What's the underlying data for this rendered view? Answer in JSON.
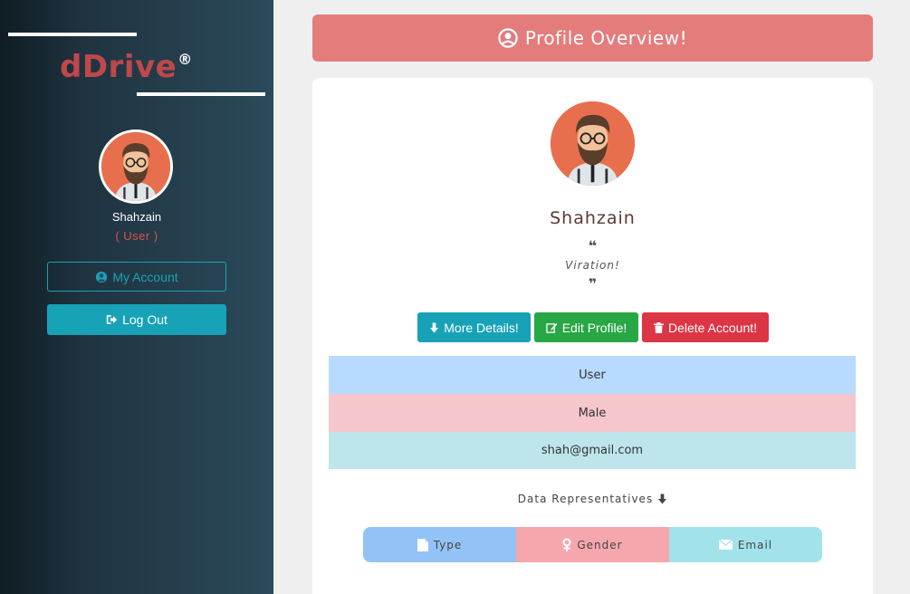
{
  "sidebar": {
    "brand": "dDrive",
    "brand_mark": "®",
    "user_name": "Shahzain",
    "user_role": "( User )",
    "my_account_label": "My Account",
    "logout_label": "Log Out"
  },
  "header": {
    "title": "Profile Overview!"
  },
  "profile": {
    "name": "Shahzain",
    "quote_open": "❝",
    "bio": "Viration!",
    "quote_close": "❞",
    "actions": {
      "details_label": "More Details!",
      "edit_label": "Edit Profile!",
      "delete_label": "Delete Account!"
    },
    "rows": {
      "type": "User",
      "gender": "Male",
      "email": "shah@gmail.com"
    },
    "data_rep_label": "Data Representatives",
    "legend": {
      "type": "Type",
      "gender": "Gender",
      "email": "Email"
    }
  },
  "colors": {
    "header": "#e47c7c",
    "info": "#17a2b8",
    "success": "#28a745",
    "danger": "#dc3545",
    "brand": "#c0474a"
  },
  "icons": [
    "user-circle-icon",
    "logout-icon",
    "arrow-down-icon",
    "edit-icon",
    "trash-icon",
    "file-icon",
    "female-icon",
    "envelope-icon"
  ]
}
